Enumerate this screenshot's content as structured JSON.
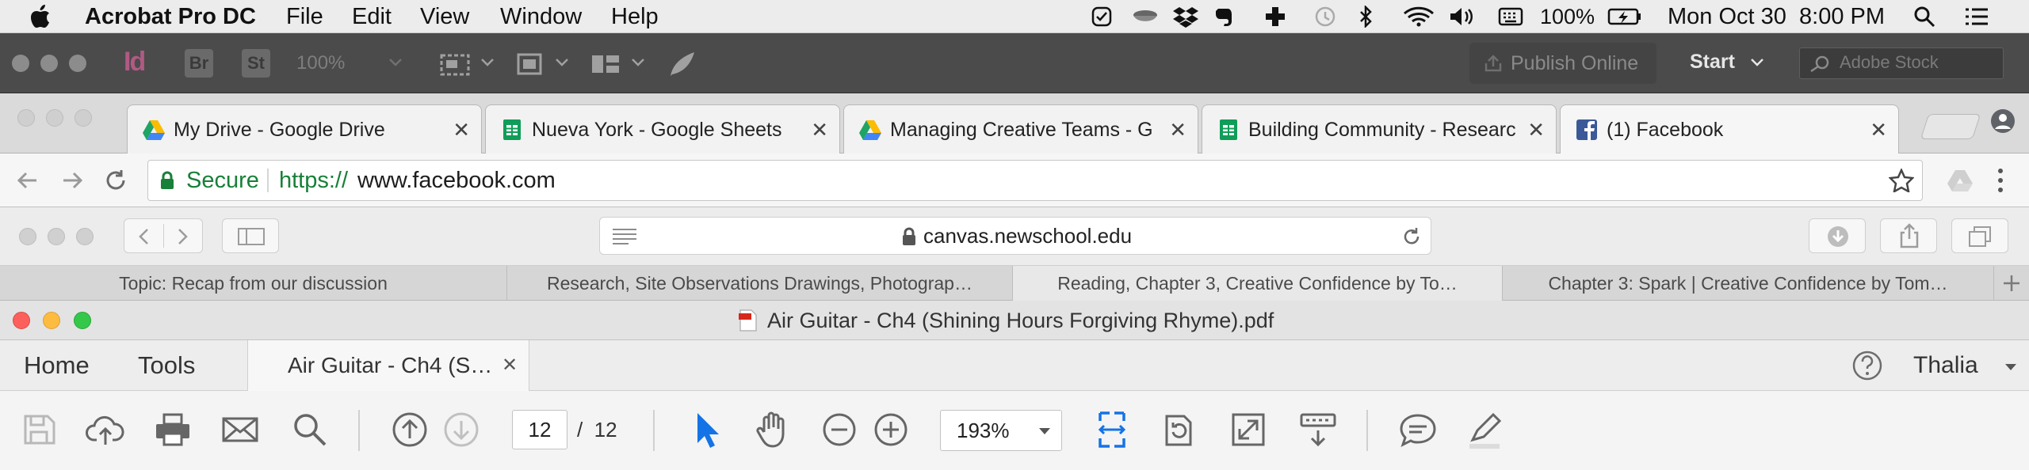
{
  "menubar": {
    "app_name": "Acrobat Pro DC",
    "items": [
      "File",
      "Edit",
      "View",
      "Window",
      "Help"
    ],
    "battery": "100%",
    "datetime": "Mon Oct 30  8:00 PM"
  },
  "indesign_bar": {
    "app_badges": [
      "Br",
      "St"
    ],
    "zoom": "100%",
    "publish_label": "Publish Online",
    "start_label": "Start",
    "search_placeholder": "Adobe Stock"
  },
  "chrome": {
    "tabs": [
      {
        "title": "My Drive - Google Drive",
        "favicon": "google-drive-icon"
      },
      {
        "title": "Nueva York - Google Sheets",
        "favicon": "google-sheets-icon"
      },
      {
        "title": "Managing Creative Teams - G",
        "favicon": "google-drive-icon"
      },
      {
        "title": "Building Community - Researc",
        "favicon": "google-sheets-icon"
      },
      {
        "title": "(1) Facebook",
        "favicon": "facebook-icon"
      }
    ],
    "secure_label": "Secure",
    "url_scheme": "https://",
    "url_host": "www.facebook.com",
    "colors": {
      "secure": "#188038"
    }
  },
  "safari": {
    "address": "canvas.newschool.edu",
    "tabs": [
      "Topic: Recap from our discussion",
      "Research, Site Observations Drawings, Photograp…",
      "Reading, Chapter 3, Creative Confidence by To…",
      "Chapter 3: Spark | Creative Confidence by Tom…"
    ]
  },
  "acrobat": {
    "window_title": "Air Guitar - Ch4 (Shining Hours Forgiving Rhyme).pdf",
    "nav": {
      "home": "Home",
      "tools": "Tools"
    },
    "doc_tab": "Air Guitar - Ch4 (S…",
    "user": "Thalia",
    "page_current": "12",
    "page_total": "/  12",
    "zoom": "193%",
    "colors": {
      "accent": "#1473e6"
    }
  }
}
